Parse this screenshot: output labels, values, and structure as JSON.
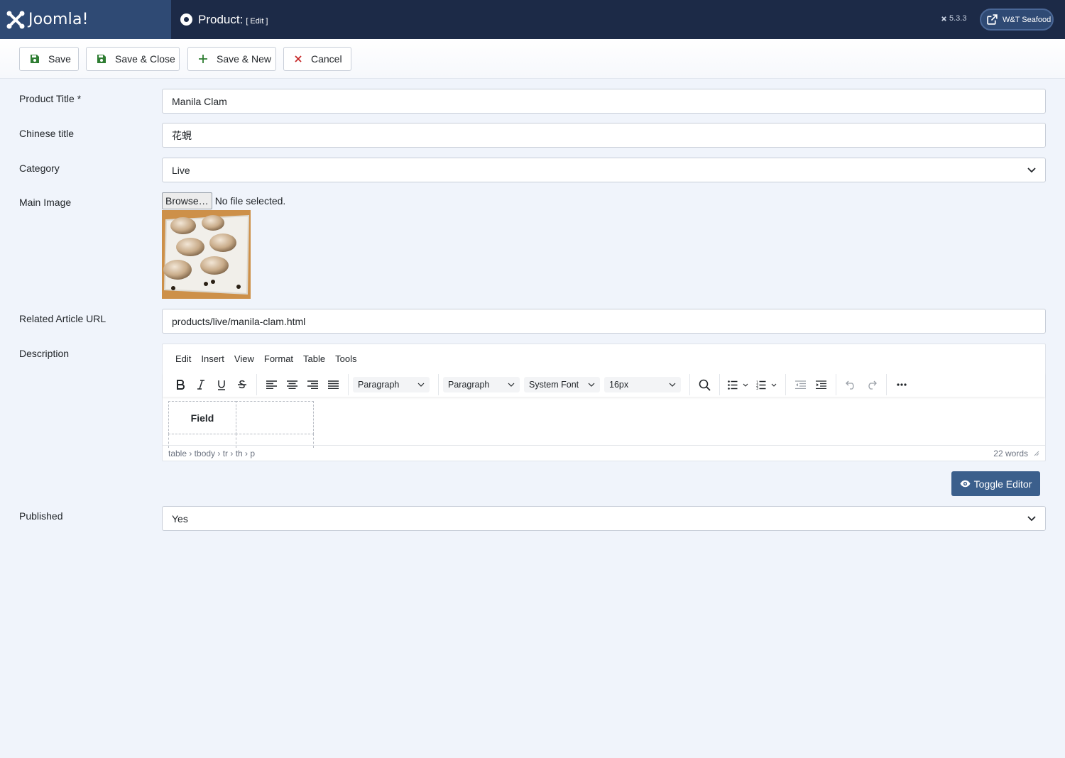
{
  "header": {
    "brand": "Joomla!",
    "page_title": "Product:",
    "page_subtitle": "[ Edit ]",
    "version": "5.3.3",
    "site_name": "W&T Seafood"
  },
  "toolbar": {
    "save_label": "Save",
    "save_close_label": "Save & Close",
    "save_new_label": "Save & New",
    "cancel_label": "Cancel"
  },
  "form": {
    "product_title_label": "Product Title *",
    "product_title_value": "Manila Clam",
    "chinese_title_label": "Chinese title",
    "chinese_title_value": "花蜆",
    "category_label": "Category",
    "category_value": "Live",
    "main_image_label": "Main Image",
    "browse_label": "Browse…",
    "no_file_text": "No file selected.",
    "related_url_label": "Related Article URL",
    "related_url_value": "products/live/manila-clam.html",
    "description_label": "Description",
    "published_label": "Published",
    "published_value": "Yes"
  },
  "editor": {
    "menu": [
      "Edit",
      "Insert",
      "View",
      "Format",
      "Table",
      "Tools"
    ],
    "block_format": "Paragraph",
    "paragraph_style": "Paragraph",
    "font_family": "System Font",
    "font_size": "16px",
    "table_header_cell": "Field",
    "path": "table › tbody › tr › th › p",
    "word_count": "22 words"
  },
  "toggle_editor_label": "Toggle Editor",
  "colors": {
    "header_bg": "#1c2a47",
    "brand_bg": "#2f4a74",
    "save_icon": "#2e7d32",
    "cancel_icon": "#c62828",
    "primary_button": "#3b5f8c"
  }
}
